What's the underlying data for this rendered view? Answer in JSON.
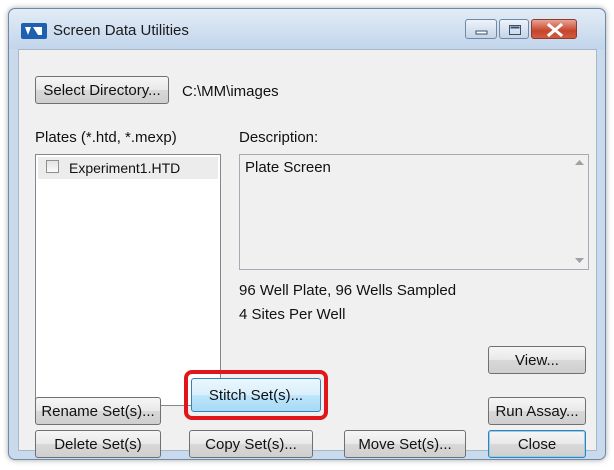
{
  "window": {
    "title": "Screen Data Utilities",
    "icon": "screen-data-utilities-app-icon",
    "caption_buttons": [
      "minimize-icon",
      "maximize-icon",
      "close-icon"
    ]
  },
  "directory": {
    "select_button_label": "Select Directory...",
    "path": "C:\\MM\\images"
  },
  "plates": {
    "label": "Plates (*.htd, *.mexp)",
    "items": [
      {
        "name": "Experiment1.HTD",
        "checked": false
      }
    ]
  },
  "description": {
    "label": "Description:",
    "text": "Plate Screen",
    "info_line1": "96 Well Plate, 96 Wells Sampled",
    "info_line2": "4 Sites Per Well"
  },
  "buttons": {
    "view": "View...",
    "rename": "Rename Set(s)...",
    "stitch": "Stitch Set(s)...",
    "run_assay": "Run Assay...",
    "delete": "Delete Set(s)",
    "copy": "Copy Set(s)...",
    "move": "Move Set(s)...",
    "close": "Close"
  },
  "colors": {
    "highlight": "#e0161b",
    "hot_button": "#bee6fd",
    "titlebar": "#c2d5eb"
  }
}
